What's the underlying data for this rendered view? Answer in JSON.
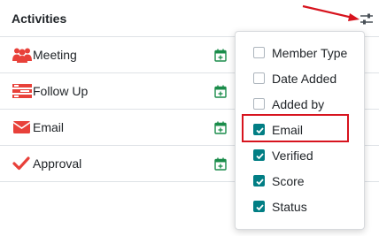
{
  "header": {
    "title": "Activities"
  },
  "activities": [
    {
      "label": "Meeting",
      "icon": "users-icon",
      "color": "#e8413a"
    },
    {
      "label": "Follow Up",
      "icon": "tasks-icon",
      "color": "#e8413a"
    },
    {
      "label": "Email",
      "icon": "envelope-icon",
      "color": "#e8413a"
    },
    {
      "label": "Approval",
      "icon": "check-icon",
      "color": "#e8413a"
    }
  ],
  "columns_menu": {
    "options": [
      {
        "label": "Member Type",
        "checked": false
      },
      {
        "label": "Date Added",
        "checked": false
      },
      {
        "label": "Added by",
        "checked": false
      },
      {
        "label": "Email",
        "checked": true
      },
      {
        "label": "Verified",
        "checked": true
      },
      {
        "label": "Score",
        "checked": true
      },
      {
        "label": "Status",
        "checked": true
      }
    ]
  },
  "colors": {
    "accent": "#017e84",
    "annotation_red": "#d7141e",
    "calendar_icon": "#1a8c4a"
  }
}
